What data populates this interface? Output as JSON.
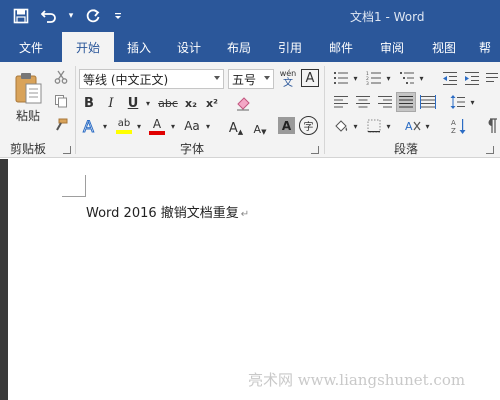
{
  "window": {
    "title": "文档1  -  Word"
  },
  "qat": {
    "dropdown_glyph": "▾"
  },
  "tabs": [
    {
      "label": "文件"
    },
    {
      "label": "开始"
    },
    {
      "label": "插入"
    },
    {
      "label": "设计"
    },
    {
      "label": "布局"
    },
    {
      "label": "引用"
    },
    {
      "label": "邮件"
    },
    {
      "label": "审阅"
    },
    {
      "label": "视图"
    },
    {
      "label": "帮"
    }
  ],
  "ribbon": {
    "clipboard": {
      "label": "剪贴板",
      "paste_label": "粘贴"
    },
    "font": {
      "label": "字体",
      "font_name": "等线 (中文正文)",
      "font_size": "五号",
      "phonetic_top": "wén",
      "phonetic_bottom": "文",
      "border_char": "A",
      "bold": "B",
      "italic": "I",
      "underline": "U",
      "strike": "abc",
      "subscript": "x₂",
      "superscript": "x²",
      "grow": "A",
      "shrink": "A",
      "case": "Aa",
      "highlight_char": "ab",
      "color_char": "A",
      "shading_char": "A",
      "enclose_char": "字"
    },
    "paragraph": {
      "label": "段落"
    }
  },
  "document": {
    "text": "Word 2016  撤销文档重复",
    "para_mark": "↵"
  },
  "watermark": "亮术网 www.liangshunet.com",
  "colors": {
    "title_bar": "#2b579a",
    "ribbon": "#f3f3f3",
    "highlight": "#ffff00",
    "font_color": "#e00000"
  }
}
